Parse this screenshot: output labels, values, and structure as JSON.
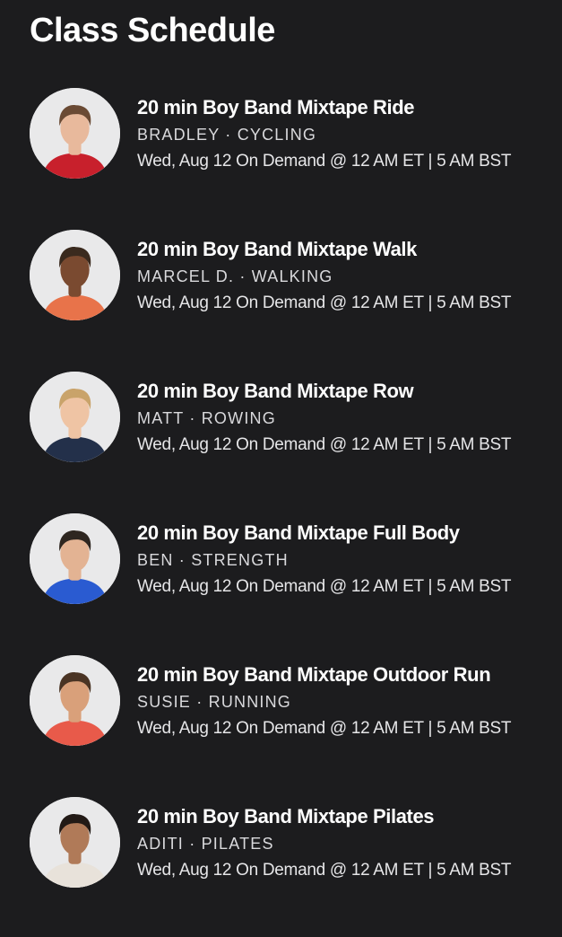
{
  "page": {
    "title": "Class Schedule"
  },
  "colors": {
    "background": "#1c1c1e",
    "title_text": "#ffffff",
    "meta_text": "#d9d9dc",
    "avatar_background": "#e9e9ea"
  },
  "classes": [
    {
      "title": "20 min Boy Band Mixtape Ride",
      "meta": "BRADLEY · CYCLING",
      "time": "Wed, Aug 12 On Demand @ 12 AM ET | 5 AM BST",
      "avatar_icon": "instructor-avatar-bradley",
      "shirt_color": "#c8202c",
      "hair_color": "#6a4a34",
      "skin_color": "#e8b99c"
    },
    {
      "title": "20 min Boy Band Mixtape Walk",
      "meta": "MARCEL D. · WALKING",
      "time": "Wed, Aug 12 On Demand @ 12 AM ET | 5 AM BST",
      "avatar_icon": "instructor-avatar-marcel",
      "shirt_color": "#e8734a",
      "hair_color": "#3a2a1e",
      "skin_color": "#7a4a30"
    },
    {
      "title": "20 min Boy Band Mixtape Row",
      "meta": "MATT · ROWING",
      "time": "Wed, Aug 12 On Demand @ 12 AM ET | 5 AM BST",
      "avatar_icon": "instructor-avatar-matt",
      "shirt_color": "#23304a",
      "hair_color": "#c9a36a",
      "skin_color": "#efc4a4"
    },
    {
      "title": "20 min Boy Band Mixtape Full Body",
      "meta": "BEN · STRENGTH",
      "time": "Wed, Aug 12 On Demand @ 12 AM ET | 5 AM BST",
      "avatar_icon": "instructor-avatar-ben",
      "shirt_color": "#2a5bd1",
      "hair_color": "#2e2620",
      "skin_color": "#e3b393"
    },
    {
      "title": "20 min Boy Band Mixtape Outdoor Run",
      "meta": "SUSIE · RUNNING",
      "time": "Wed, Aug 12 On Demand @ 12 AM ET | 5 AM BST",
      "avatar_icon": "instructor-avatar-susie",
      "shirt_color": "#e85a4a",
      "hair_color": "#4a3424",
      "skin_color": "#d9a07a"
    },
    {
      "title": "20 min Boy Band Mixtape Pilates",
      "meta": "ADITI · PILATES",
      "time": "Wed, Aug 12 On Demand @ 12 AM ET | 5 AM BST",
      "avatar_icon": "instructor-avatar-aditi",
      "shirt_color": "#e8e2da",
      "hair_color": "#221a16",
      "skin_color": "#b07a58"
    }
  ]
}
